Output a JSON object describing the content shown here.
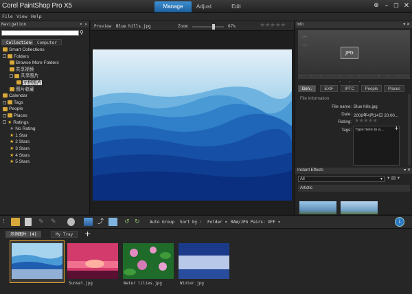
{
  "app": {
    "title": "Corel PaintShop Pro X5",
    "tabs": [
      {
        "label": "Manage",
        "active": true
      },
      {
        "label": "Adjust",
        "active": false
      },
      {
        "label": "Edit",
        "active": false
      }
    ]
  },
  "menu": {
    "items": [
      "File",
      "View",
      "Help"
    ]
  },
  "navigation": {
    "title": "Navigation",
    "tabs": [
      "Collections",
      "Computer"
    ],
    "tree": [
      {
        "label": "Smart Collections",
        "icon": "smart-collections-icon",
        "kind": "folder"
      },
      {
        "label": "Folders",
        "icon": "folder-icon",
        "kind": "folder"
      },
      {
        "label": "Browse More Folders",
        "icon": "folder-icon",
        "kind": "folder"
      },
      {
        "label": "共享视频",
        "icon": "folder-icon",
        "kind": "folder"
      },
      {
        "label": "共享图片",
        "icon": "folder-icon",
        "kind": "folder"
      },
      {
        "label": "示例图片",
        "icon": "folder-icon",
        "kind": "folder",
        "selected": true
      },
      {
        "label": "图片收藏",
        "icon": "folder-icon",
        "kind": "folder"
      },
      {
        "label": "Calendar",
        "icon": "calendar-icon",
        "kind": "folder"
      },
      {
        "label": "Tags",
        "icon": "tag-icon",
        "kind": "folder"
      },
      {
        "label": "People",
        "icon": "people-icon",
        "kind": "folder"
      },
      {
        "label": "Places",
        "icon": "places-icon",
        "kind": "folder"
      },
      {
        "label": "Ratings",
        "icon": "star-icon",
        "kind": "star"
      },
      {
        "label": "No Rating",
        "icon": "star-icon",
        "kind": "star-grey"
      },
      {
        "label": "1 Star",
        "icon": "star-icon",
        "kind": "star"
      },
      {
        "label": "2 Stars",
        "icon": "star-icon",
        "kind": "star"
      },
      {
        "label": "3 Stars",
        "icon": "star-icon",
        "kind": "star"
      },
      {
        "label": "4 Stars",
        "icon": "star-icon",
        "kind": "star"
      },
      {
        "label": "5 Stars",
        "icon": "star-icon",
        "kind": "star"
      }
    ]
  },
  "preview": {
    "label": "Preview",
    "filename": "Blue hills.jpg",
    "zoom_label": "Zoom",
    "zoom_value": "67%",
    "zoom_fraction": 0.67
  },
  "info": {
    "title": "Info",
    "badge": "JPG",
    "tabs": [
      "Gen..",
      "EXIF",
      "IPTC",
      "People",
      "Places"
    ],
    "section": "File information",
    "file_name_label": "File name:",
    "file_name": "Blue hills.jpg",
    "date_label": "Date:",
    "date": "2008年4月14日 20:00...",
    "rating_label": "Rating:",
    "tags_label": "Tags:",
    "tags_placeholder": "Type here to a..."
  },
  "effects": {
    "title": "Instant Effects",
    "filter": "All",
    "category": "Artistic"
  },
  "toolbar": {
    "auto_group": "Auto Group",
    "sort_by": "Sort by :",
    "sort_value": "Folder",
    "raw_pairs": "RAW/JPG Pairs: OFF"
  },
  "tray": {
    "tabs": [
      "示例图片 (4)",
      "My Tray"
    ],
    "add_label": "+",
    "items": [
      {
        "label": "",
        "selected": true
      },
      {
        "label": "Sunset.jpg",
        "selected": false
      },
      {
        "label": "Water lilies.jpg",
        "selected": false
      },
      {
        "label": "Winter.jpg",
        "selected": false
      }
    ]
  },
  "colors": {
    "accent": "#2a78c0",
    "folder": "#d8a83a",
    "star": "#e6b830"
  }
}
